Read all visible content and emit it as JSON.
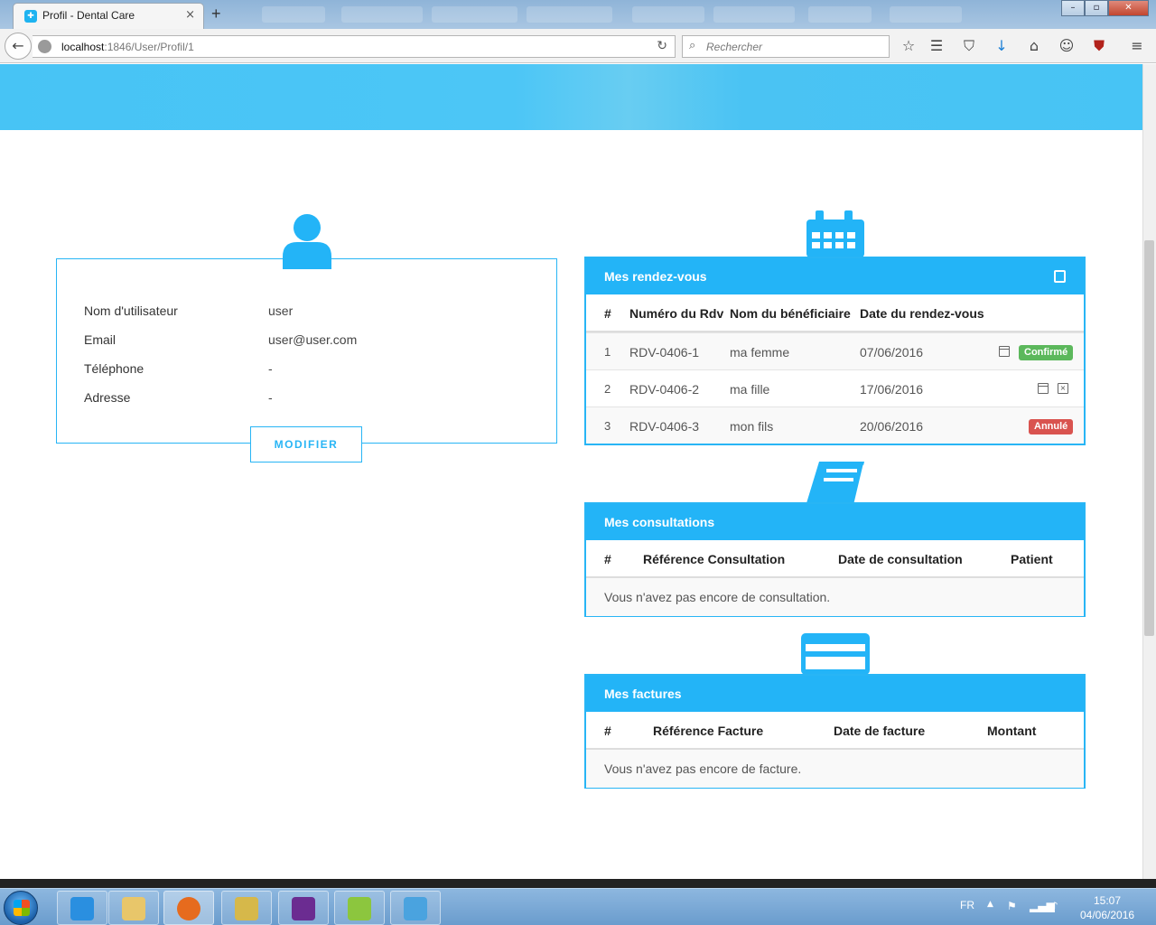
{
  "browser": {
    "tab_title": "Profil - Dental Care",
    "tab_close": "×",
    "new_tab": "+",
    "url_host": "localhost",
    "url_path": ":1846/User/Profil/1",
    "search_placeholder": "Rechercher",
    "window_controls": [
      "–",
      "▫",
      "✕"
    ]
  },
  "profile": {
    "fields": [
      {
        "label": "Nom d'utilisateur",
        "value": "user"
      },
      {
        "label": "Email",
        "value": "user@user.com"
      },
      {
        "label": "Téléphone",
        "value": "-"
      },
      {
        "label": "Adresse",
        "value": "-"
      }
    ],
    "modify_label": "MODIFIER"
  },
  "appointments": {
    "title": "Mes rendez-vous",
    "columns": [
      "#",
      "Numéro du Rdv",
      "Nom du bénéficiaire",
      "Date du rendez-vous"
    ],
    "rows": [
      {
        "num": "1",
        "ref": "RDV-0406-1",
        "name": "ma femme",
        "date": "07/06/2016",
        "status": "Confirmé"
      },
      {
        "num": "2",
        "ref": "RDV-0406-2",
        "name": "ma fille",
        "date": "17/06/2016",
        "status": ""
      },
      {
        "num": "3",
        "ref": "RDV-0406-3",
        "name": "mon fils",
        "date": "20/06/2016",
        "status": "Annulé"
      }
    ]
  },
  "consultations": {
    "title": "Mes consultations",
    "columns": [
      "#",
      "Référence Consultation",
      "Date de consultation",
      "Patient"
    ],
    "empty": "Vous n'avez pas encore de consultation."
  },
  "invoices": {
    "title": "Mes factures",
    "columns": [
      "#",
      "Référence Facture",
      "Date de facture",
      "Montant"
    ],
    "empty": "Vous n'avez pas encore de facture."
  },
  "taskbar": {
    "language": "FR",
    "time": "15:07",
    "date": "04/06/2016"
  },
  "colors": {
    "accent": "#23b4f7",
    "success": "#5cb85c",
    "danger": "#d9534f"
  }
}
